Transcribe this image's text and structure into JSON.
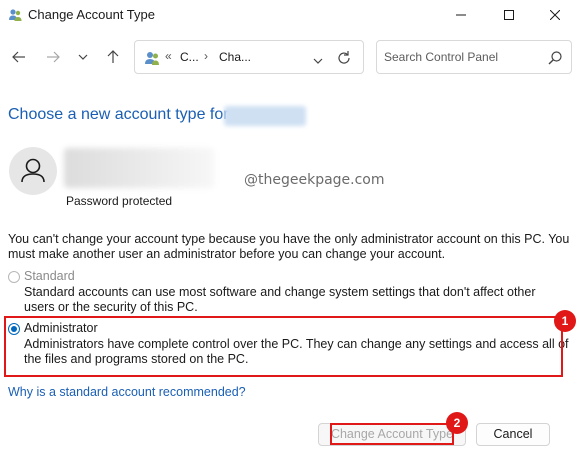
{
  "window": {
    "title": "Change Account Type",
    "icon": "users-icon"
  },
  "nav": {
    "address_segments": [
      "C...",
      "Cha..."
    ],
    "chevron": "«",
    "separator": "›",
    "search_placeholder": "Search Control Panel"
  },
  "content": {
    "heading": "Choose a new account type for",
    "password_status": "Password protected",
    "watermark": "@thegeekpage.com",
    "info": "You can't change your account type because you have the only administrator account on this PC. You must make another user an administrator before you can change your account.",
    "options": [
      {
        "label": "Standard",
        "description": "Standard accounts can use most software and change system settings that don't affect other users or the security of this PC.",
        "selected": false,
        "enabled": false
      },
      {
        "label": "Administrator",
        "description": "Administrators have complete control over the PC. They can change any settings and access all of the files and programs stored on the PC.",
        "selected": true,
        "enabled": true
      }
    ],
    "help_link": "Why is a standard account recommended?"
  },
  "buttons": {
    "change": "Change Account Type",
    "cancel": "Cancel"
  },
  "annotations": {
    "badge_1": "1",
    "badge_2": "2",
    "highlight_color": "#e01818"
  },
  "colors": {
    "accent": "#0067c0",
    "link": "#1a5fb4"
  }
}
